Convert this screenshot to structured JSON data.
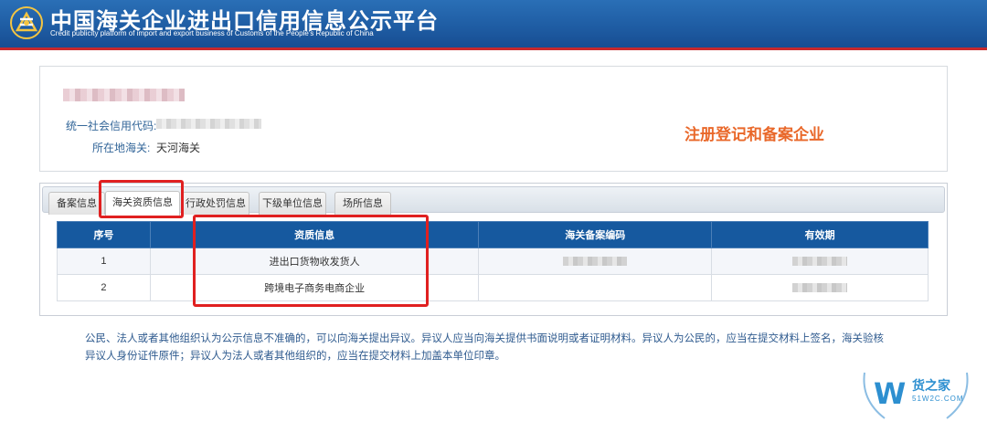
{
  "header": {
    "title_cn": "中国海关企业进出口信用信息公示平台",
    "title_en": "Credit publicity platform of import and export business of Customs of the People's Republic of China"
  },
  "company": {
    "credit_code_label": "统一社会信用代码:",
    "customs_label": "所在地海关:",
    "customs_value": "天河海关",
    "registration_type": "注册登记和备案企业"
  },
  "tabs": [
    {
      "label": "备案信息",
      "active": false
    },
    {
      "label": "海关资质信息",
      "active": true
    },
    {
      "label": "行政处罚信息",
      "active": false
    },
    {
      "label": "下级单位信息",
      "active": false
    },
    {
      "label": "场所信息",
      "active": false
    }
  ],
  "table": {
    "headers": [
      "序号",
      "资质信息",
      "海关备案编码",
      "有效期"
    ],
    "rows": [
      {
        "index": "1",
        "qualification": "进出口货物收发货人"
      },
      {
        "index": "2",
        "qualification": "跨境电子商务电商企业"
      }
    ]
  },
  "notice": {
    "line1": "公民、法人或者其他组织认为公示信息不准确的，可以向海关提出异议。异议人应当向海关提供书面说明或者证明材料。异议人为公民的，应当在提交材料上签名，海关验核",
    "line2": "异议人身份证件原件；异议人为法人或者其他组织的，应当在提交材料上加盖本单位印章。"
  },
  "watermark": {
    "brand": "货之家",
    "url": "51W2C.COM"
  },
  "colors": {
    "header_blue": "#1f5da4",
    "header_accent": "#c7292d",
    "table_header": "#16599f",
    "highlight_red": "#e02020",
    "registration_orange": "#e9682a"
  }
}
